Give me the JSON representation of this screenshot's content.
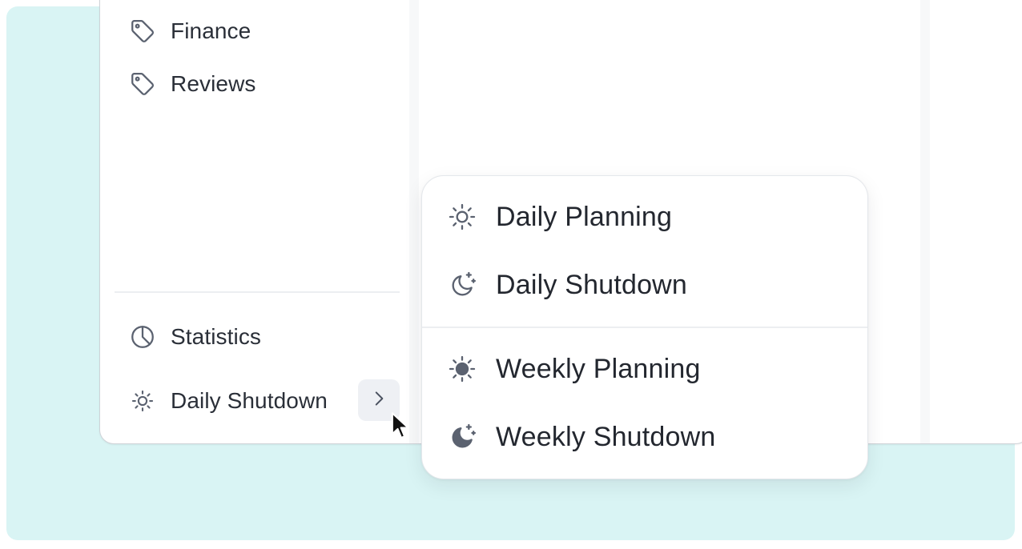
{
  "sidebar": {
    "items": [
      {
        "label": "Finance",
        "icon": "tag-icon"
      },
      {
        "label": "Reviews",
        "icon": "tag-icon"
      }
    ],
    "footer_items": [
      {
        "label": "Statistics",
        "icon": "pie-chart-icon"
      },
      {
        "label": "Daily Shutdown",
        "icon": "sun-icon"
      }
    ],
    "expand_icon": "chevron-right-icon"
  },
  "ritual_menu": {
    "daily": [
      {
        "label": "Daily Planning",
        "icon": "sun-outline-icon"
      },
      {
        "label": "Daily Shutdown",
        "icon": "moon-stars-outline-icon"
      }
    ],
    "weekly": [
      {
        "label": "Weekly Planning",
        "icon": "sun-filled-icon"
      },
      {
        "label": "Weekly Shutdown",
        "icon": "moon-stars-filled-icon"
      }
    ]
  },
  "colors": {
    "background": "#d9f4f4",
    "text": "#23272f",
    "icon": "#5b6270",
    "divider": "#eceef1"
  }
}
